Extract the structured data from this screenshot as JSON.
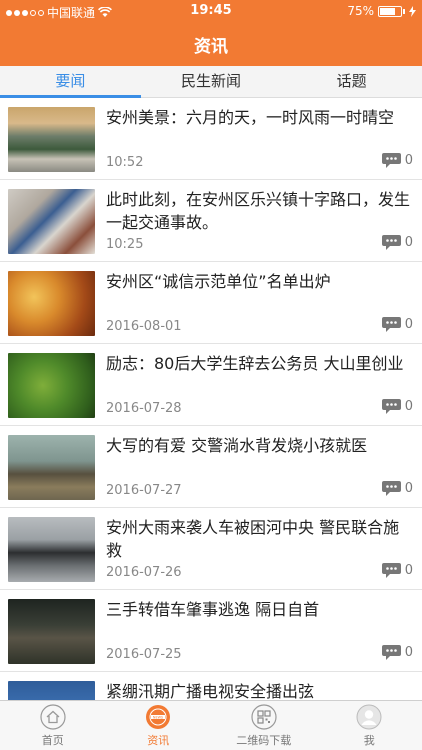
{
  "status": {
    "carrier": "中国联通",
    "time": "19:45",
    "battery": "75%",
    "battery_level": 0.75
  },
  "nav": {
    "title": "资讯"
  },
  "tabs": [
    {
      "label": "要闻",
      "active": true
    },
    {
      "label": "民生新闻",
      "active": false
    },
    {
      "label": "话题",
      "active": false
    }
  ],
  "news": [
    {
      "title": "安州美景：六月的天，一时风雨一时晴空",
      "date": "10:52",
      "comments": "0"
    },
    {
      "title": "此时此刻，在安州区乐兴镇十字路口，发生一起交通事故。",
      "date": "10:25",
      "comments": "0"
    },
    {
      "title": "安州区“诚信示范单位”名单出炉",
      "date": "2016-08-01",
      "comments": "0"
    },
    {
      "title": "励志：80后大学生辞去公务员 大山里创业",
      "date": "2016-07-28",
      "comments": "0"
    },
    {
      "title": "大写的有爱 交警淌水背发烧小孩就医",
      "date": "2016-07-27",
      "comments": "0"
    },
    {
      "title": "安州大雨来袭人车被困河中央 警民联合施救",
      "date": "2016-07-26",
      "comments": "0"
    },
    {
      "title": "三手转借车肇事逃逸  隔日自首",
      "date": "2016-07-25",
      "comments": "0"
    },
    {
      "title": "紧绷汛期广播电视安全播出弦",
      "date": "",
      "comments": ""
    }
  ],
  "tabbar": [
    {
      "label": "首页",
      "icon": "home-icon",
      "active": false
    },
    {
      "label": "资讯",
      "icon": "news-icon",
      "active": true
    },
    {
      "label": "二维码下载",
      "icon": "qrcode-icon",
      "active": false
    },
    {
      "label": "我",
      "icon": "user-icon",
      "active": false
    }
  ],
  "colors": {
    "brand": "#f27a33",
    "tab_active": "#3a8ee6"
  }
}
